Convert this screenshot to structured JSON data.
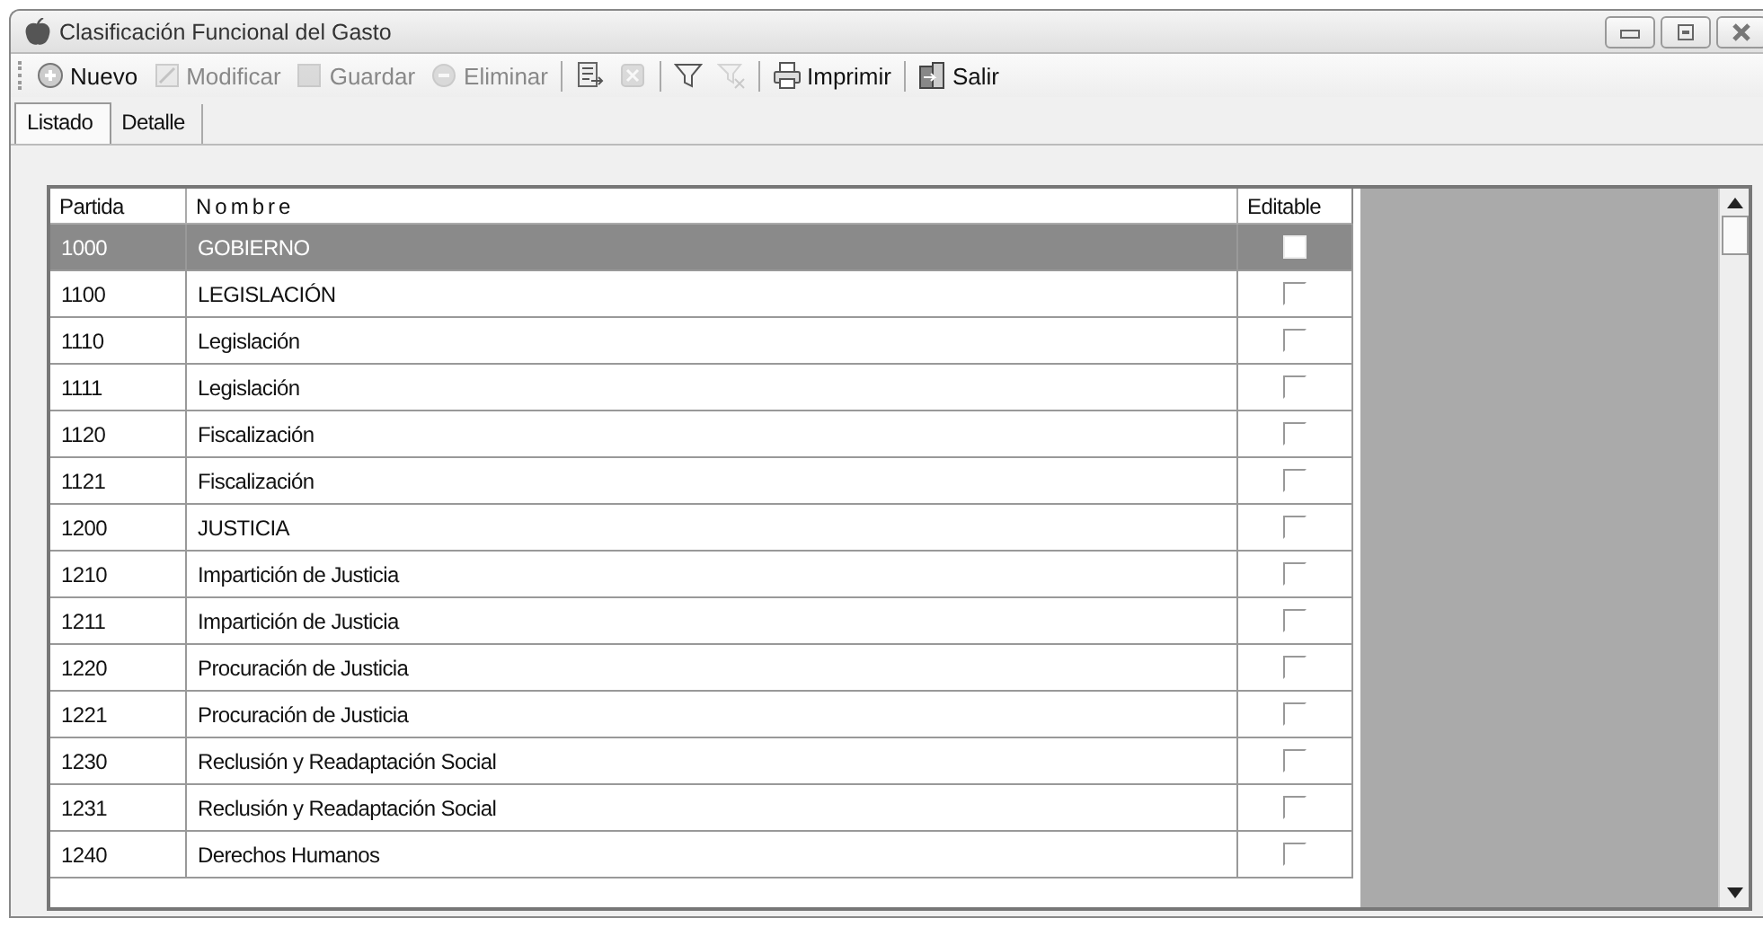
{
  "window": {
    "title": "Clasificación Funcional del Gasto"
  },
  "toolbar": [
    {
      "kind": "button",
      "label": "Nuevo",
      "disabled": false
    },
    {
      "kind": "button",
      "label": "Modificar",
      "disabled": true
    },
    {
      "kind": "button",
      "label": "Guardar",
      "disabled": true
    },
    {
      "kind": "button",
      "label": "Eliminar",
      "disabled": true
    },
    {
      "kind": "separator"
    },
    {
      "kind": "button",
      "disabled": false
    },
    {
      "kind": "button",
      "disabled": true
    },
    {
      "kind": "separator"
    },
    {
      "kind": "button",
      "disabled": false
    },
    {
      "kind": "button",
      "disabled": true
    },
    {
      "kind": "separator"
    },
    {
      "kind": "button",
      "label": "Imprimir",
      "disabled": false
    },
    {
      "kind": "separator"
    },
    {
      "kind": "button",
      "label": "Salir",
      "disabled": false
    }
  ],
  "tabs": [
    {
      "label": "Listado",
      "selected": true
    },
    {
      "label": "Detalle",
      "selected": false
    }
  ],
  "table": {
    "columns": [
      "Partida",
      "Nombre",
      "Editable"
    ],
    "rows": [
      {
        "partida": "1000",
        "nombre": "GOBIERNO",
        "checked": false,
        "selected": true
      },
      {
        "partida": "1100",
        "nombre": "LEGISLACIÓN",
        "checked": false,
        "selected": false
      },
      {
        "partida": "1110",
        "nombre": "Legislación",
        "checked": false,
        "selected": false
      },
      {
        "partida": "1111",
        "nombre": "Legislación",
        "checked": false,
        "selected": false
      },
      {
        "partida": "1120",
        "nombre": "Fiscalización",
        "checked": false,
        "selected": false
      },
      {
        "partida": "1121",
        "nombre": "Fiscalización",
        "checked": false,
        "selected": false
      },
      {
        "partida": "1200",
        "nombre": "JUSTICIA",
        "checked": false,
        "selected": false
      },
      {
        "partida": "1210",
        "nombre": "Impartición de Justicia",
        "checked": false,
        "selected": false
      },
      {
        "partida": "1211",
        "nombre": "Impartición de Justicia",
        "checked": false,
        "selected": false
      },
      {
        "partida": "1220",
        "nombre": "Procuración de Justicia",
        "checked": false,
        "selected": false
      },
      {
        "partida": "1221",
        "nombre": "Procuración de Justicia",
        "checked": false,
        "selected": false
      },
      {
        "partida": "1230",
        "nombre": "Reclusión y Readaptación Social",
        "checked": false,
        "selected": false
      },
      {
        "partida": "1231",
        "nombre": "Reclusión y Readaptación Social",
        "checked": false,
        "selected": false
      },
      {
        "partida": "1240",
        "nombre": "Derechos Humanos",
        "checked": false,
        "selected": false
      }
    ]
  }
}
